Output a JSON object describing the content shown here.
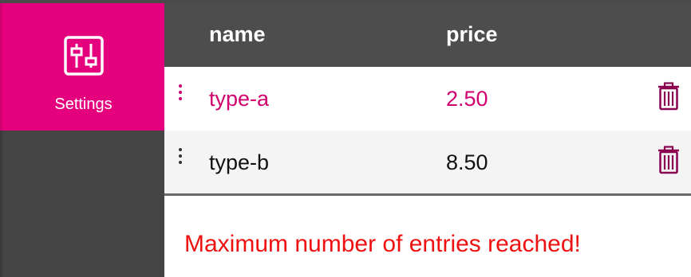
{
  "sidebar": {
    "items": [
      {
        "label": "Settings",
        "icon": "sliders-icon",
        "active": true
      }
    ]
  },
  "table": {
    "columns": [
      "name",
      "price"
    ],
    "rows": [
      {
        "name": "type-a",
        "price": "2.50",
        "selected": true
      },
      {
        "name": "type-b",
        "price": "8.50",
        "selected": false
      }
    ]
  },
  "message": "Maximum number of entries reached!",
  "colors": {
    "accent": "#e5007e",
    "sidebar": "#444444",
    "header": "#4d4d4d",
    "error": "#ee1111",
    "trash": "#8a0050"
  }
}
